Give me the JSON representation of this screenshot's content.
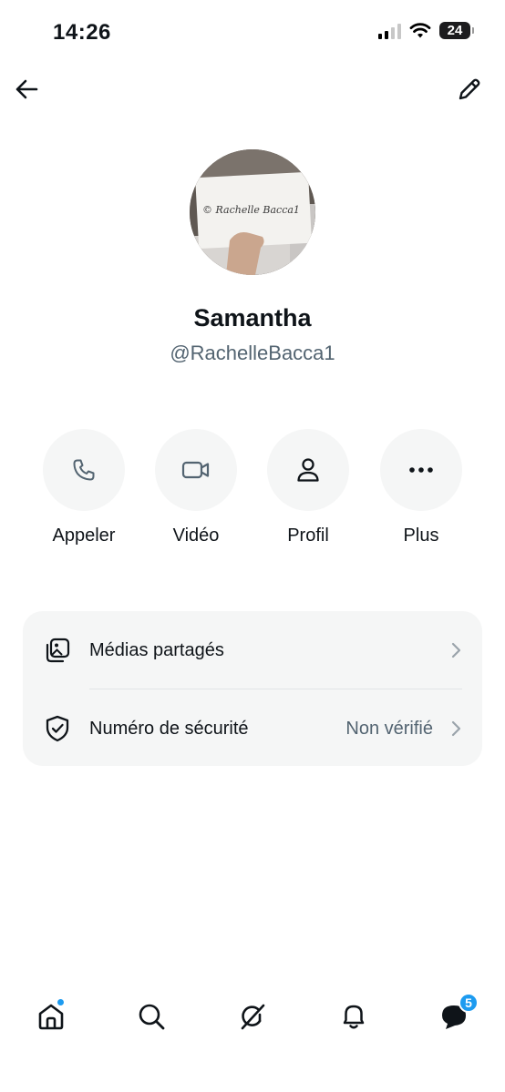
{
  "status_bar": {
    "time": "14:26",
    "battery": "24",
    "icons": [
      "signal-icon",
      "wifi-icon",
      "battery-icon"
    ]
  },
  "header": {
    "back_icon": "arrow-left-icon",
    "edit_icon": "pencil-icon"
  },
  "profile": {
    "name": "Samantha",
    "handle": "@RachelleBacca1",
    "avatar_sign_text": "© Rachelle Bacca1"
  },
  "actions": [
    {
      "label": "Appeler",
      "icon": "phone-icon"
    },
    {
      "label": "Vidéo",
      "icon": "video-icon"
    },
    {
      "label": "Profil",
      "icon": "person-icon"
    },
    {
      "label": "Plus",
      "icon": "more-icon"
    }
  ],
  "settings": {
    "shared_media": {
      "label": "Médias partagés",
      "icon": "media-icon"
    },
    "safety_number": {
      "label": "Numéro de sécurité",
      "value": "Non vérifié",
      "icon": "shield-check-icon"
    }
  },
  "bottom_nav": {
    "items": [
      "home-icon",
      "search-icon",
      "grok-icon",
      "bell-icon",
      "messages-icon"
    ],
    "messages_badge": "5"
  },
  "colors": {
    "accent": "#1d9bf0",
    "text_primary": "#0f1419",
    "text_secondary": "#536471",
    "surface": "#f5f6f6"
  }
}
